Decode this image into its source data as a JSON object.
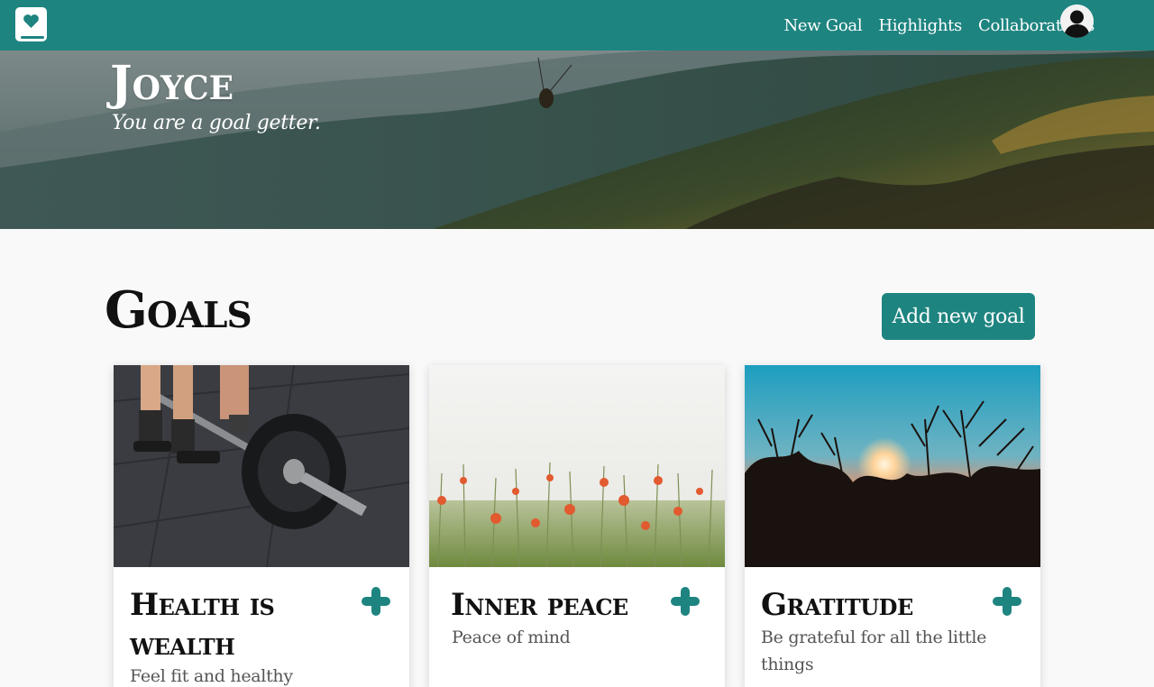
{
  "nav": {
    "links": [
      "New Goal",
      "Highlights",
      "Collaborations"
    ],
    "logo_icon": "heart-book-icon",
    "avatar_icon": "user-avatar-icon"
  },
  "hero": {
    "name": "Joyce",
    "tagline": "You are a goal getter."
  },
  "goals": {
    "title": "Goals",
    "add_button": "Add new goal",
    "cards": [
      {
        "title": "Health is wealth",
        "description": "Feel fit and healthy",
        "image": "barbell-photo",
        "action_icon": "plus-icon"
      },
      {
        "title": "Inner peace",
        "description": "Peace of mind",
        "image": "poppy-field-photo",
        "action_icon": "plus-icon"
      },
      {
        "title": "Gratitude",
        "description": "Be grateful for all the little things",
        "image": "sunset-photo",
        "action_icon": "plus-icon"
      }
    ]
  },
  "colors": {
    "primary": "#1e8480",
    "text_dark": "#111111",
    "text_muted": "#555555"
  }
}
